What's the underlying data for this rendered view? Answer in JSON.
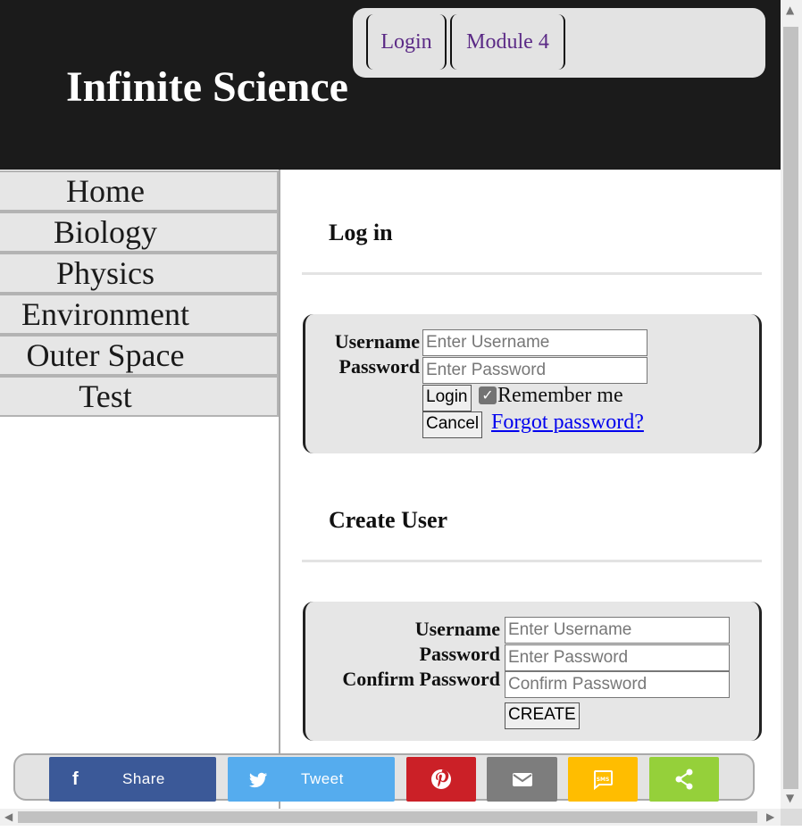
{
  "site": {
    "title": "Infinite Science"
  },
  "top_nav": {
    "items": [
      {
        "label": "Login"
      },
      {
        "label": "Module 4"
      }
    ]
  },
  "sidebar": {
    "items": [
      {
        "label": "Home"
      },
      {
        "label": "Biology"
      },
      {
        "label": "Physics"
      },
      {
        "label": "Environment"
      },
      {
        "label": "Outer Space"
      },
      {
        "label": "Test"
      }
    ]
  },
  "login": {
    "heading": "Log in",
    "username_label": "Username",
    "password_label": "Password",
    "username_placeholder": "Enter Username",
    "password_placeholder": "Enter Password",
    "login_button": "Login",
    "remember_label": "Remember me",
    "remember_checked": true,
    "cancel_button": "Cancel",
    "forgot_link": "Forgot password?"
  },
  "create_user": {
    "heading": "Create User",
    "username_label": "Username",
    "password_label": "Password",
    "confirm_label": "Confirm Password",
    "username_placeholder": "Enter Username",
    "password_placeholder": "Enter Password",
    "confirm_placeholder": "Confirm Password",
    "create_button": "CREATE"
  },
  "share_bar": {
    "buttons": [
      {
        "name": "facebook",
        "icon": "facebook-icon",
        "label": "Share",
        "color": "#3b5998"
      },
      {
        "name": "twitter",
        "icon": "twitter-icon",
        "label": "Tweet",
        "color": "#55acee"
      },
      {
        "name": "pinterest",
        "icon": "pinterest-icon",
        "label": "",
        "color": "#cb2027"
      },
      {
        "name": "email",
        "icon": "email-icon",
        "label": "",
        "color": "#7d7d7d"
      },
      {
        "name": "sms",
        "icon": "sms-icon",
        "label": "",
        "color": "#ffbd00"
      },
      {
        "name": "share",
        "icon": "share-icon",
        "label": "",
        "color": "#95d03a"
      }
    ]
  }
}
